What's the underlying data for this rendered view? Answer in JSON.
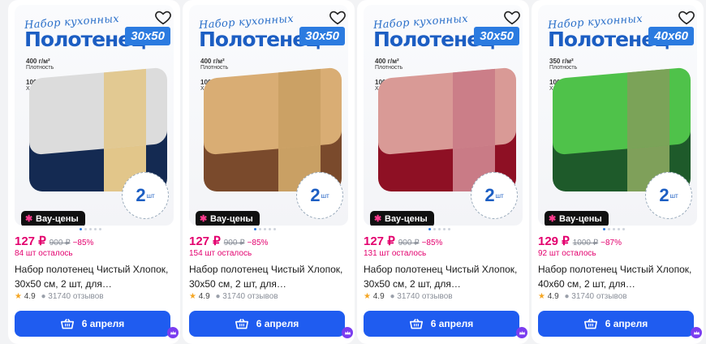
{
  "colors": {
    "accent": "#1f5cf0",
    "price": "#e3006e",
    "title_blue": "#1c5ec3",
    "badge_blue": "#2b7be0"
  },
  "products": [
    {
      "set_title": "Набор кухонных",
      "big_title": "Полотенец",
      "size": "30x50",
      "spec_density": "400 г/м²",
      "spec_density_label": "Плотность",
      "spec_cotton": "100%",
      "spec_cotton_label": "Хлопок",
      "qty": "2",
      "qty_unit": "шт",
      "wow_label": "Вау-цены",
      "price": "127 ₽",
      "old_price": "900 ₽",
      "discount": "−85%",
      "stock": "84 шт осталось",
      "name": "Набор полотенец Чистый Хлопок, 30x50 см, 2 шт, для…",
      "rating": "4.9",
      "reviews": "31740 отзывов",
      "delivery": "6 апреля",
      "towel_top": "#dcdcdc",
      "towel_bottom": "#142a52",
      "band": "#e2c68a"
    },
    {
      "set_title": "Набор кухонных",
      "big_title": "Полотенец",
      "size": "30x50",
      "spec_density": "400 г/м²",
      "spec_density_label": "Плотность",
      "spec_cotton": "100%",
      "spec_cotton_label": "Хлопок",
      "qty": "2",
      "qty_unit": "шт",
      "wow_label": "Вау-цены",
      "price": "127 ₽",
      "old_price": "900 ₽",
      "discount": "−85%",
      "stock": "154 шт осталось",
      "name": "Набор полотенец Чистый Хлопок, 30x50 см, 2 шт, для…",
      "rating": "4.9",
      "reviews": "31740 отзывов",
      "delivery": "6 апреля",
      "towel_top": "#d9ad74",
      "towel_bottom": "#7a4a2c",
      "band": "#c9a064"
    },
    {
      "set_title": "Набор кухонных",
      "big_title": "Полотенец",
      "size": "30x50",
      "spec_density": "400 г/м²",
      "spec_density_label": "Плотность",
      "spec_cotton": "100%",
      "spec_cotton_label": "Хлопок",
      "qty": "2",
      "qty_unit": "шт",
      "wow_label": "Вау-цены",
      "price": "127 ₽",
      "old_price": "900 ₽",
      "discount": "−85%",
      "stock": "131 шт осталось",
      "name": "Набор полотенец Чистый Хлопок, 30x50 см, 2 шт, для…",
      "rating": "4.9",
      "reviews": "31740 отзывов",
      "delivery": "6 апреля",
      "towel_top": "#d99a96",
      "towel_bottom": "#8e1024",
      "band": "#c97b86"
    },
    {
      "set_title": "Набор кухонных",
      "big_title": "Полотенец",
      "size": "40x60",
      "spec_density": "350 г/м²",
      "spec_density_label": "Плотность",
      "spec_cotton": "100%",
      "spec_cotton_label": "Хлопок",
      "qty": "2",
      "qty_unit": "шт",
      "wow_label": "Вау-цены",
      "price": "129 ₽",
      "old_price": "1000 ₽",
      "discount": "−87%",
      "stock": "92 шт осталось",
      "name": "Набор полотенец Чистый Хлопок, 40x60 см, 2 шт, для…",
      "rating": "4.9",
      "reviews": "31740 отзывов",
      "delivery": "6 апреля",
      "towel_top": "#4fc24a",
      "towel_bottom": "#1e5a2a",
      "band": "#7fa05a"
    }
  ]
}
